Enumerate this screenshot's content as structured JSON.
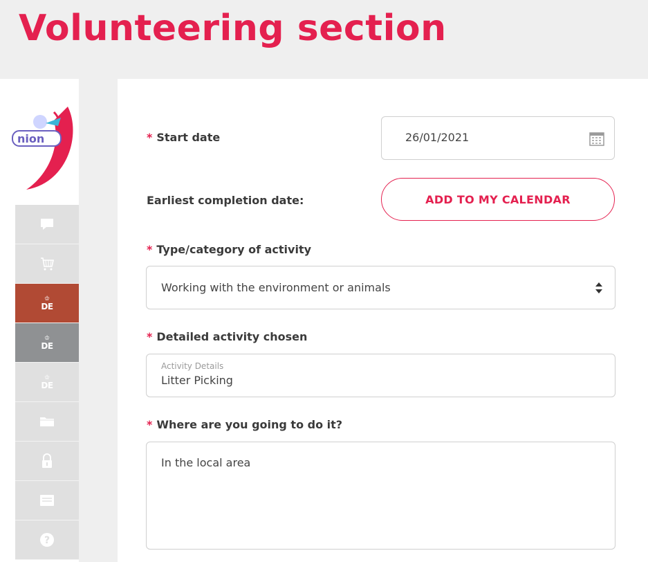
{
  "page": {
    "title": "Volunteering section"
  },
  "sidebar": {
    "logo_text": "nion",
    "items": [
      {
        "name": "chat",
        "icon": "chat-icon",
        "state": "normal"
      },
      {
        "name": "cart",
        "icon": "cart-icon",
        "state": "normal"
      },
      {
        "name": "de-red",
        "icon": "dofe-icon",
        "label": "DE",
        "state": "active-red"
      },
      {
        "name": "de-grey",
        "icon": "dofe-icon",
        "label": "DE",
        "state": "active-grey"
      },
      {
        "name": "de-light",
        "icon": "dofe-icon",
        "label": "DE",
        "state": "normal"
      },
      {
        "name": "folder",
        "icon": "folder-icon",
        "state": "normal"
      },
      {
        "name": "lock",
        "icon": "lock-icon",
        "state": "normal"
      },
      {
        "name": "message",
        "icon": "message-icon",
        "state": "normal"
      },
      {
        "name": "help",
        "icon": "help-icon",
        "state": "normal"
      }
    ]
  },
  "form": {
    "required_mark": "*",
    "start_date": {
      "label": "Start date",
      "value": "26/01/2021"
    },
    "earliest_completion": {
      "label": "Earliest completion date:",
      "button": "ADD TO MY CALENDAR"
    },
    "activity_type": {
      "label": "Type/category of activity",
      "value": "Working with the environment or animals"
    },
    "activity_detail": {
      "label": "Detailed activity chosen",
      "float_label": "Activity Details",
      "value": "Litter Picking"
    },
    "location": {
      "label": "Where are you going to do it?",
      "value": "In the local area"
    }
  },
  "colors": {
    "accent": "#e4204f",
    "active_red": "#b14a34",
    "active_grey": "#8f9193",
    "nav_bg": "#e0e0e0"
  }
}
